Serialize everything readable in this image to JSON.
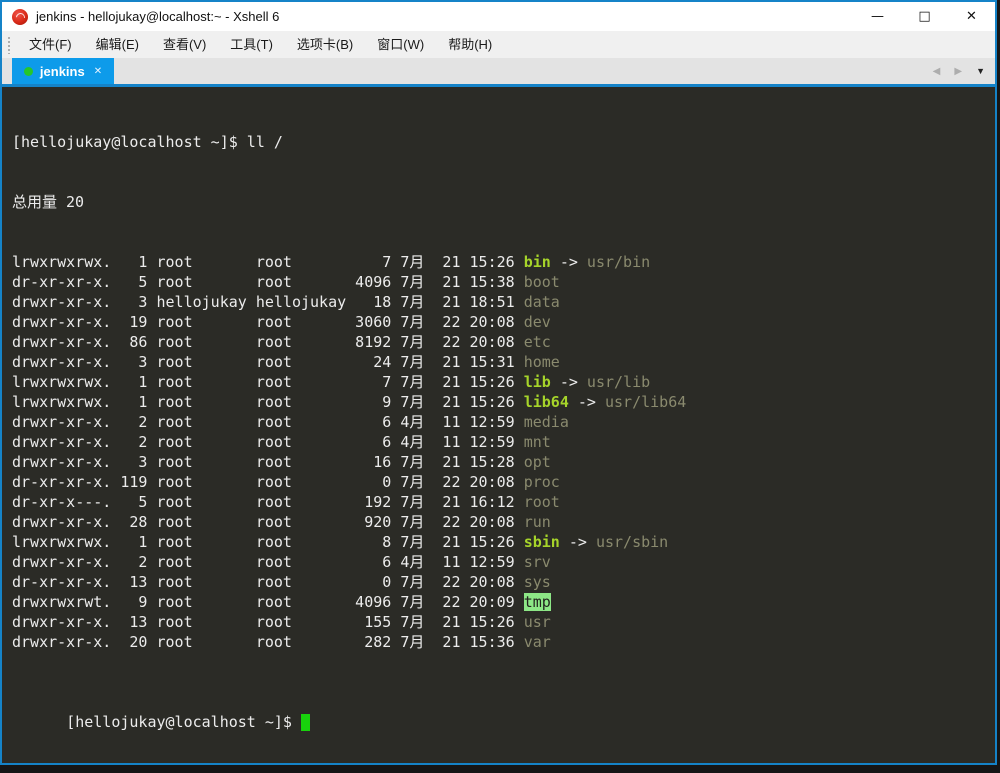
{
  "window": {
    "title": "jenkins - hellojukay@localhost:~ - Xshell 6",
    "controls": {
      "minimize_icon": "—",
      "maximize_icon": "□",
      "close_icon": "✕"
    }
  },
  "menu": {
    "items": [
      {
        "label": "文件(F)"
      },
      {
        "label": "编辑(E)"
      },
      {
        "label": "查看(V)"
      },
      {
        "label": "工具(T)"
      },
      {
        "label": "选项卡(B)"
      },
      {
        "label": "窗口(W)"
      },
      {
        "label": "帮助(H)"
      }
    ]
  },
  "tabbar": {
    "tab": {
      "label": "jenkins",
      "active": true,
      "close_icon": "✕"
    },
    "nav": {
      "prev_icon": "◀",
      "next_icon": "▶",
      "menu_icon": "▼"
    }
  },
  "terminal": {
    "command_line": "[hellojukay@localhost ~]$ ll /",
    "total_line": "总用量 20",
    "arrow": "->",
    "listing": [
      {
        "perm": "lrwxrwxrwx.",
        "links": 1,
        "owner": "root",
        "group": "root",
        "size": 7,
        "month": "7月",
        "day": "21",
        "time": "15:26",
        "name": "bin",
        "type": "symlink",
        "target": "usr/bin"
      },
      {
        "perm": "dr-xr-xr-x.",
        "links": 5,
        "owner": "root",
        "group": "root",
        "size": 4096,
        "month": "7月",
        "day": "21",
        "time": "15:38",
        "name": "boot",
        "type": "dir"
      },
      {
        "perm": "drwxr-xr-x.",
        "links": 3,
        "owner": "hellojukay",
        "group": "hellojukay",
        "size": 18,
        "month": "7月",
        "day": "21",
        "time": "18:51",
        "name": "data",
        "type": "dir"
      },
      {
        "perm": "drwxr-xr-x.",
        "links": 19,
        "owner": "root",
        "group": "root",
        "size": 3060,
        "month": "7月",
        "day": "22",
        "time": "20:08",
        "name": "dev",
        "type": "dir"
      },
      {
        "perm": "drwxr-xr-x.",
        "links": 86,
        "owner": "root",
        "group": "root",
        "size": 8192,
        "month": "7月",
        "day": "22",
        "time": "20:08",
        "name": "etc",
        "type": "dir"
      },
      {
        "perm": "drwxr-xr-x.",
        "links": 3,
        "owner": "root",
        "group": "root",
        "size": 24,
        "month": "7月",
        "day": "21",
        "time": "15:31",
        "name": "home",
        "type": "dir"
      },
      {
        "perm": "lrwxrwxrwx.",
        "links": 1,
        "owner": "root",
        "group": "root",
        "size": 7,
        "month": "7月",
        "day": "21",
        "time": "15:26",
        "name": "lib",
        "type": "symlink",
        "target": "usr/lib"
      },
      {
        "perm": "lrwxrwxrwx.",
        "links": 1,
        "owner": "root",
        "group": "root",
        "size": 9,
        "month": "7月",
        "day": "21",
        "time": "15:26",
        "name": "lib64",
        "type": "symlink",
        "target": "usr/lib64"
      },
      {
        "perm": "drwxr-xr-x.",
        "links": 2,
        "owner": "root",
        "group": "root",
        "size": 6,
        "month": "4月",
        "day": "11",
        "time": "12:59",
        "name": "media",
        "type": "dir"
      },
      {
        "perm": "drwxr-xr-x.",
        "links": 2,
        "owner": "root",
        "group": "root",
        "size": 6,
        "month": "4月",
        "day": "11",
        "time": "12:59",
        "name": "mnt",
        "type": "dir"
      },
      {
        "perm": "drwxr-xr-x.",
        "links": 3,
        "owner": "root",
        "group": "root",
        "size": 16,
        "month": "7月",
        "day": "21",
        "time": "15:28",
        "name": "opt",
        "type": "dir"
      },
      {
        "perm": "dr-xr-xr-x.",
        "links": 119,
        "owner": "root",
        "group": "root",
        "size": 0,
        "month": "7月",
        "day": "22",
        "time": "20:08",
        "name": "proc",
        "type": "dir"
      },
      {
        "perm": "dr-xr-x---.",
        "links": 5,
        "owner": "root",
        "group": "root",
        "size": 192,
        "month": "7月",
        "day": "21",
        "time": "16:12",
        "name": "root",
        "type": "dir"
      },
      {
        "perm": "drwxr-xr-x.",
        "links": 28,
        "owner": "root",
        "group": "root",
        "size": 920,
        "month": "7月",
        "day": "22",
        "time": "20:08",
        "name": "run",
        "type": "dir"
      },
      {
        "perm": "lrwxrwxrwx.",
        "links": 1,
        "owner": "root",
        "group": "root",
        "size": 8,
        "month": "7月",
        "day": "21",
        "time": "15:26",
        "name": "sbin",
        "type": "symlink",
        "target": "usr/sbin"
      },
      {
        "perm": "drwxr-xr-x.",
        "links": 2,
        "owner": "root",
        "group": "root",
        "size": 6,
        "month": "4月",
        "day": "11",
        "time": "12:59",
        "name": "srv",
        "type": "dir"
      },
      {
        "perm": "dr-xr-xr-x.",
        "links": 13,
        "owner": "root",
        "group": "root",
        "size": 0,
        "month": "7月",
        "day": "22",
        "time": "20:08",
        "name": "sys",
        "type": "dir"
      },
      {
        "perm": "drwxrwxrwt.",
        "links": 9,
        "owner": "root",
        "group": "root",
        "size": 4096,
        "month": "7月",
        "day": "22",
        "time": "20:09",
        "name": "tmp",
        "type": "tmp"
      },
      {
        "perm": "drwxr-xr-x.",
        "links": 13,
        "owner": "root",
        "group": "root",
        "size": 155,
        "month": "7月",
        "day": "21",
        "time": "15:26",
        "name": "usr",
        "type": "dir"
      },
      {
        "perm": "drwxr-xr-x.",
        "links": 20,
        "owner": "root",
        "group": "root",
        "size": 282,
        "month": "7月",
        "day": "21",
        "time": "15:36",
        "name": "var",
        "type": "dir"
      }
    ],
    "prompt": "[hellojukay@localhost ~]$"
  },
  "colors": {
    "window_border": "#1583c8",
    "tab_active_bg": "#0d9bea",
    "tab_status_dot": "#25c72c",
    "terminal_bg": "#2b2b26",
    "terminal_fg": "#ececec",
    "symlink_name": "#a6d42a",
    "directory_name": "#8a8a6e",
    "tmp_highlight_bg": "#8de786",
    "cursor_green": "#18d20c"
  }
}
